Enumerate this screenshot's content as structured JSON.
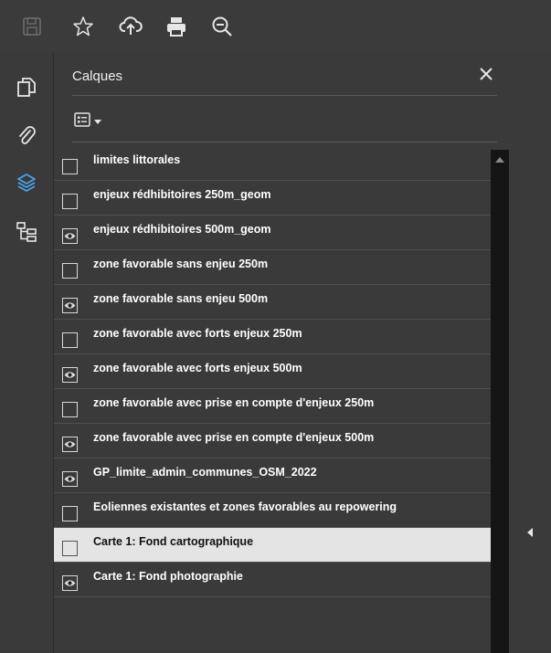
{
  "toolbar": {
    "icons": [
      "save-icon",
      "star-icon",
      "upload-cloud-icon",
      "print-icon",
      "zoom-out-icon"
    ]
  },
  "sidebar": {
    "icons": [
      "pages-icon",
      "attachment-icon",
      "layers-icon",
      "structure-icon"
    ],
    "active": "layers-icon",
    "accent_color": "#4aa3f0"
  },
  "panel": {
    "title": "Calques",
    "close_icon": "close-icon",
    "options_icon": "list-options-icon"
  },
  "layers": [
    {
      "label": "limites littorales",
      "visible": false
    },
    {
      "label": "enjeux rédhibitoires 250m_geom",
      "visible": false
    },
    {
      "label": "enjeux rédhibitoires 500m_geom",
      "visible": true
    },
    {
      "label": "zone favorable sans enjeu 250m",
      "visible": false
    },
    {
      "label": "zone favorable sans enjeu 500m",
      "visible": true
    },
    {
      "label": "zone favorable avec forts enjeux 250m",
      "visible": false
    },
    {
      "label": "zone favorable avec forts enjeux 500m",
      "visible": true
    },
    {
      "label": "zone favorable avec prise en compte d'enjeux 250m",
      "visible": false
    },
    {
      "label": "zone favorable avec prise en compte d'enjeux 500m",
      "visible": true
    },
    {
      "label": "GP_limite_admin_communes_OSM_2022",
      "visible": true
    },
    {
      "label": "Eoliennes existantes et zones favorables au repowering",
      "visible": false
    },
    {
      "label": "Carte 1: Fond cartographique",
      "visible": false,
      "selected": true
    },
    {
      "label": "Carte 1: Fond photographie",
      "visible": true
    }
  ],
  "colors": {
    "toolbar_bg": "#3b3b3b",
    "panel_bg": "#3a3a3a",
    "selected_row": "#e4e4e4"
  }
}
